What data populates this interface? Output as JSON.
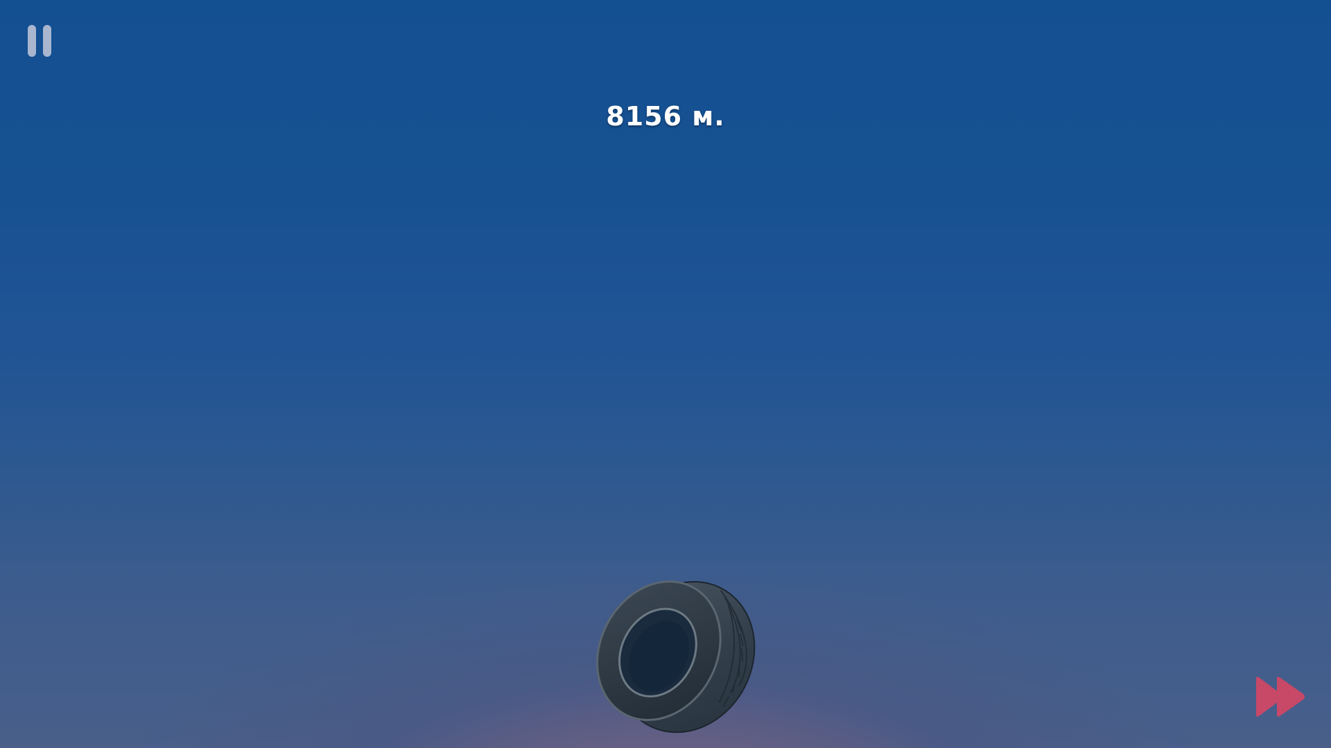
{
  "hud": {
    "distance_text": "8156 м.",
    "pause_icon": "pause-icon",
    "fast_forward_icon": "fast-forward-icon"
  },
  "scene": {
    "object": "tire",
    "sky_top_color": "#135092",
    "sky_bottom_color": "#8e6880"
  },
  "colors": {
    "pause_icon": "#a9b6cf",
    "fast_forward_icon": "#c84868",
    "distance_text": "#ffffff"
  }
}
